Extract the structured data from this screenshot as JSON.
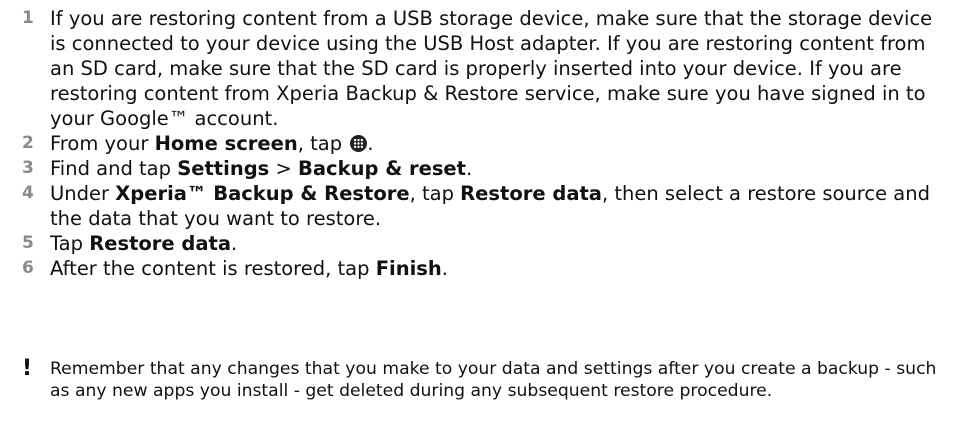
{
  "steps": [
    {
      "num": "1",
      "text": "If you are restoring content from a USB storage device, make sure that the storage device is connected to your device using the USB Host adapter. If you are restoring content from an SD card, make sure that the SD card is properly inserted into your device. If you are restoring content from Xperia Backup & Restore service, make sure you have signed in to your Google™ account."
    },
    {
      "num": "2",
      "pre": "From your ",
      "bold": "Home screen",
      "post": ", tap ",
      "icon": "apps-icon",
      "end": "."
    },
    {
      "num": "3",
      "pre": "Find and tap ",
      "bold1": "Settings",
      "sep": " > ",
      "bold2": "Backup & reset",
      "end": "."
    },
    {
      "num": "4",
      "pre": "Under ",
      "bold1": "Xperia™ Backup & Restore",
      "mid": ", tap ",
      "bold2": "Restore data",
      "post": ", then select a restore source and the data that you want to restore."
    },
    {
      "num": "5",
      "pre": "Tap ",
      "bold": "Restore data",
      "end": "."
    },
    {
      "num": "6",
      "pre": "After the content is restored, tap ",
      "bold": "Finish",
      "end": "."
    }
  ],
  "note": {
    "icon": "exclamation-icon",
    "glyph": "!",
    "text": "Remember that any changes that you make to your data and settings after you create a backup - such as any new apps you install - get deleted during any subsequent restore procedure."
  },
  "colors": {
    "step_number": "#8a8a8a",
    "text": "#111111"
  }
}
